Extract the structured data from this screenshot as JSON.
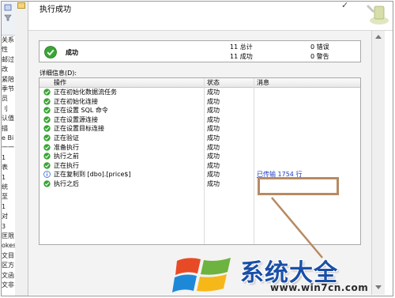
{
  "dialog": {
    "title": "执行成功"
  },
  "summary": {
    "status_text": "成功",
    "total_count": "11",
    "total_label": "总计",
    "success_count": "11",
    "success_label": "成功",
    "error_count": "0",
    "error_label": "错误",
    "warning_count": "0",
    "warning_label": "警告"
  },
  "details": {
    "label": "详细信息(D):",
    "columns": {
      "action": "操作",
      "status": "状态",
      "message": "消息"
    },
    "rows": [
      {
        "action": "正在初始化数据流任务",
        "status": "成功",
        "message": "",
        "icon": "success"
      },
      {
        "action": "正在初始化连接",
        "status": "成功",
        "message": "",
        "icon": "success"
      },
      {
        "action": "正在设置 SQL 命令",
        "status": "成功",
        "message": "",
        "icon": "success"
      },
      {
        "action": "正在设置源连接",
        "status": "成功",
        "message": "",
        "icon": "success"
      },
      {
        "action": "正在设置目标连接",
        "status": "成功",
        "message": "",
        "icon": "success"
      },
      {
        "action": "正在验证",
        "status": "成功",
        "message": "",
        "icon": "success"
      },
      {
        "action": "准备执行",
        "status": "成功",
        "message": "",
        "icon": "success"
      },
      {
        "action": "执行之前",
        "status": "成功",
        "message": "",
        "icon": "success"
      },
      {
        "action": "正在执行",
        "status": "成功",
        "message": "",
        "icon": "success"
      },
      {
        "action": "正在复制到 [dbo].[price$]",
        "status": "成功",
        "message": "已传输 1754 行",
        "icon": "info"
      },
      {
        "action": "执行之后",
        "status": "成功",
        "message": "",
        "icon": "success"
      }
    ]
  },
  "left_panel": {
    "items": [
      "关系",
      "性",
      "邮过",
      "改",
      "紧陪",
      "季节",
      "员",
      "刂",
      "认值",
      "描",
      "e Bi",
      "一一",
      "1",
      "表",
      "1",
      "统",
      "至",
      "1",
      "对",
      "3",
      "匡限",
      "okes",
      "文目",
      "区方",
      "文函",
      "文非"
    ]
  },
  "watermark": {
    "text": "系统大全",
    "url": "www.win7cn.com"
  },
  "colors": {
    "success_green": "#3aa534",
    "info_blue": "#3a6fd8",
    "highlight_border": "#b88a62",
    "link_blue": "#1f3fbf"
  }
}
